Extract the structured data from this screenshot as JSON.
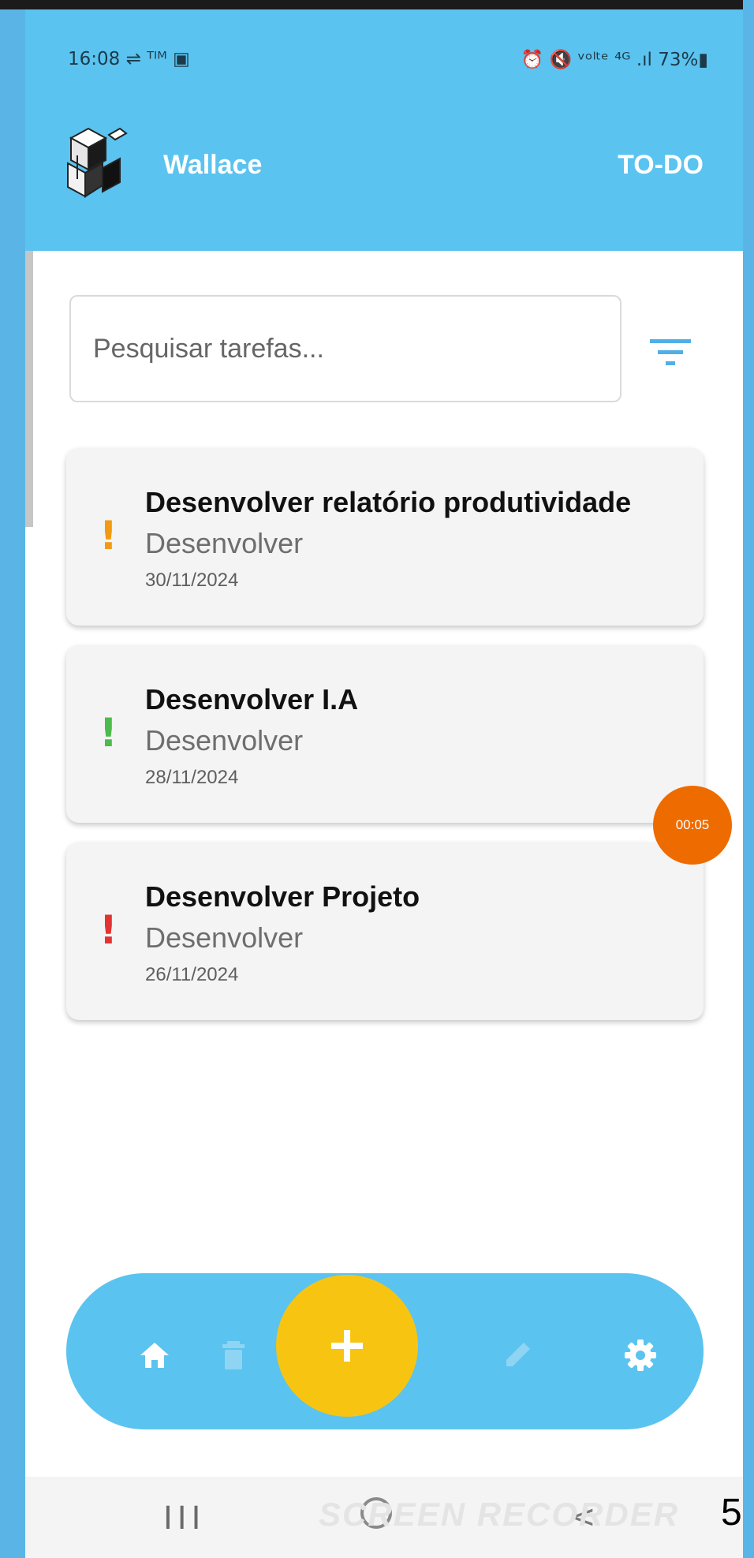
{
  "status_bar": {
    "left": "16:08 ⇌ ᵀᴵᴹ ▣",
    "right": "⏰ 🔇 ᵛᵒˡᵗᵉ ⁴ᴳ .ıl 73%▮"
  },
  "app_bar": {
    "title": "Wallace",
    "right_label": "TO-DO"
  },
  "search": {
    "placeholder": "Pesquisar tarefas..."
  },
  "tasks": [
    {
      "title": "Desenvolver relatório produtividade",
      "category": "Desenvolver",
      "date": "30/11/2024",
      "priority": "!",
      "priority_color": "#f29a11"
    },
    {
      "title": "Desenvolver I.A",
      "category": "Desenvolver",
      "date": "28/11/2024",
      "priority": "!",
      "priority_color": "#4cbb4c"
    },
    {
      "title": "Desenvolver Projeto",
      "category": "Desenvolver",
      "date": "26/11/2024",
      "priority": "!",
      "priority_color": "#e23333"
    }
  ],
  "recording_badge": "00:05",
  "bottom_nav": {
    "icons": [
      "home-icon",
      "trash-icon",
      "plus-icon",
      "pencil-icon",
      "gear-icon"
    ]
  },
  "system_nav": {
    "recents": "III"
  },
  "watermark": "SCREEN RECORDER",
  "page_number": "5",
  "colors": {
    "app_bar": "#5bc3ef",
    "fab": "#f7c511",
    "recording": "#ee6b00"
  }
}
